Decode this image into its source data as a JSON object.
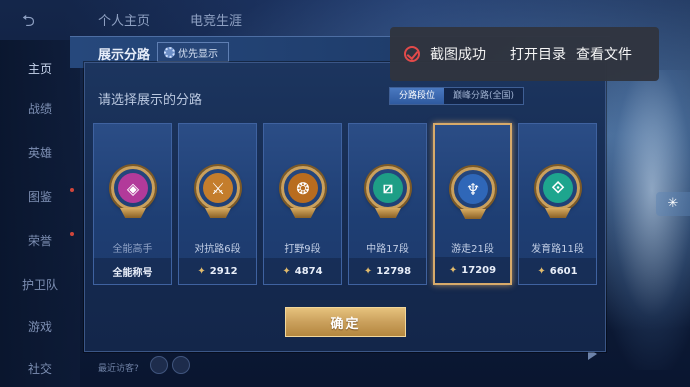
{
  "top_tabs": [
    "个人主页",
    "电竞生涯"
  ],
  "sidebar": {
    "items": [
      {
        "label": "主页",
        "active": true
      },
      {
        "label": "战绩",
        "active": false
      },
      {
        "label": "英雄",
        "active": false
      },
      {
        "label": "图鉴",
        "active": false,
        "dot": true
      },
      {
        "label": "荣誉",
        "active": false,
        "dot": true
      },
      {
        "label": "护卫队",
        "active": false
      },
      {
        "label": "游戏",
        "active": false
      },
      {
        "label": "社交",
        "active": false
      }
    ]
  },
  "dialog": {
    "title": "展示分路",
    "priority_chip": "优先显示",
    "prompt": "请选择展示的分路",
    "tabs": [
      {
        "label": "分路段位",
        "active": true
      },
      {
        "label": "巅峰分路(全国)",
        "active": false
      }
    ],
    "cards": [
      {
        "label": "全能高手",
        "footer": "全能称号",
        "show_star": false,
        "selected": false,
        "icon": "all-round-icon",
        "color": "#b23a9a"
      },
      {
        "label": "对抗路6段",
        "footer": "2912",
        "show_star": true,
        "selected": false,
        "icon": "clash-lane-icon",
        "color": "#c47d2c"
      },
      {
        "label": "打野9段",
        "footer": "4874",
        "show_star": true,
        "selected": false,
        "icon": "jungle-icon",
        "color": "#b86c1f"
      },
      {
        "label": "中路17段",
        "footer": "12798",
        "show_star": true,
        "selected": false,
        "icon": "mid-lane-icon",
        "color": "#1e9e86"
      },
      {
        "label": "游走21段",
        "footer": "17209",
        "show_star": true,
        "selected": true,
        "icon": "roam-icon",
        "color": "#2f67b8"
      },
      {
        "label": "发育路11段",
        "footer": "6601",
        "show_star": true,
        "selected": false,
        "icon": "farm-lane-icon",
        "color": "#1ea58e"
      }
    ],
    "confirm_label": "确定"
  },
  "toast": {
    "message": "截图成功",
    "open_folder": "打开目录",
    "view_file": "查看文件"
  },
  "bottom_text": "最近访客?",
  "colors": {
    "accent_gold": "#caa05c",
    "toast_red": "#e24a4a"
  }
}
